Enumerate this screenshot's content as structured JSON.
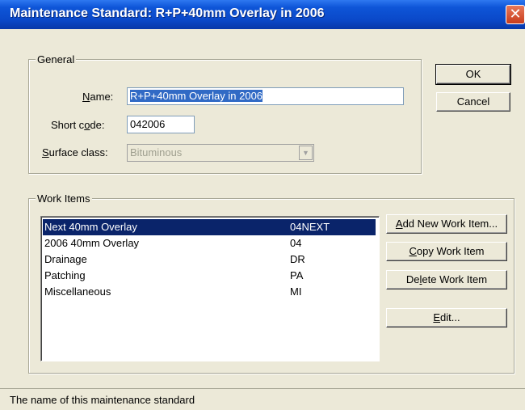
{
  "window": {
    "title": "Maintenance Standard: R+P+40mm Overlay in 2006",
    "close_glyph": "✕"
  },
  "general": {
    "label": "General",
    "name_label": "Name:",
    "name_value": "R+P+40mm Overlay in 2006",
    "short_code_label": "Short code:",
    "short_code_value": "042006",
    "surface_class_label": "Surface class:",
    "surface_class_value": "Bituminous"
  },
  "buttons": {
    "ok": "OK",
    "cancel": "Cancel"
  },
  "work_items": {
    "label": "Work Items",
    "rows": [
      {
        "name": "Next 40mm Overlay",
        "code": "04NEXT",
        "selected": true
      },
      {
        "name": "2006 40mm Overlay",
        "code": "04"
      },
      {
        "name": "Drainage",
        "code": "DR"
      },
      {
        "name": "Patching",
        "code": "PA"
      },
      {
        "name": "Miscellaneous",
        "code": "MI"
      }
    ],
    "add_button": "Add New Work Item...",
    "copy_button": "Copy Work Item",
    "delete_button": "Delete Work Item",
    "edit_button": "Edit..."
  },
  "status": {
    "text": "The name of this maintenance standard"
  },
  "colors": {
    "titlebar": "#0a48c8",
    "selection": "#0a246a",
    "face": "#ece9d8"
  }
}
